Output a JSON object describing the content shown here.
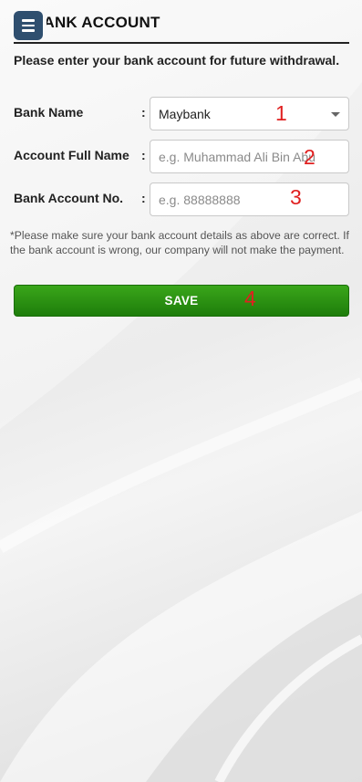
{
  "header": {
    "title": "BANK ACCOUNT",
    "menu_icon": "hamburger-menu-icon"
  },
  "intro_text": "Please enter your bank account for future withdrawal.",
  "form": {
    "bank_name": {
      "label": "Bank Name",
      "colon": ":",
      "value": "Maybank"
    },
    "account_full_name": {
      "label": "Account Full Name",
      "colon": ":",
      "value": "",
      "placeholder": "e.g. Muhammad Ali Bin Abu"
    },
    "bank_account_no": {
      "label": "Bank Account No.",
      "colon": ":",
      "value": "",
      "placeholder": "e.g. 88888888"
    }
  },
  "note": "*Please make sure your bank account details as above are correct. If the bank account is wrong, our company will not make the payment.",
  "save_button": {
    "label": "SAVE"
  },
  "annotations": [
    "1",
    "2",
    "3",
    "4"
  ],
  "colors": {
    "header_button": "#2f4f6f",
    "save_button": "#2e9514",
    "annotation": "#e02020"
  }
}
